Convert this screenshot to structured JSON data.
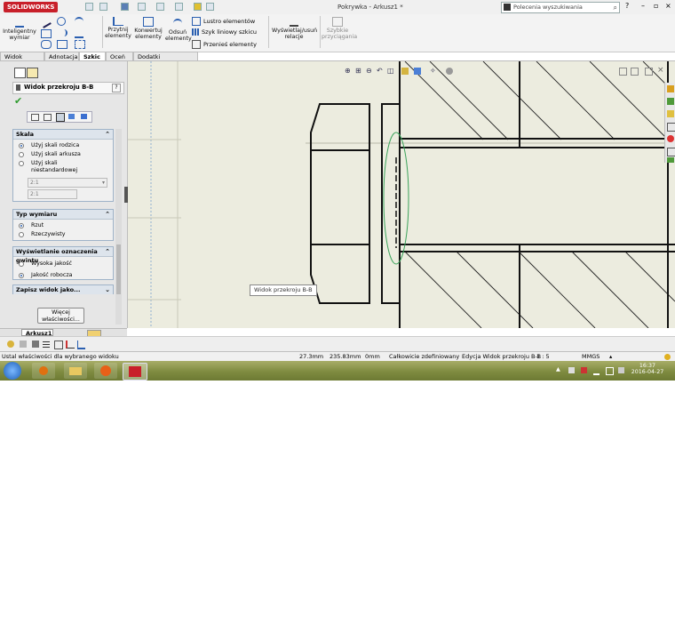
{
  "app": {
    "logo_text": "SOLIDWORKS",
    "document_title": "Pokrywka - Arkusz1 *",
    "search_placeholder": "Polecenia wyszukiwania"
  },
  "ribbon": {
    "smart_dimension": "Inteligentny wymiar",
    "trim": "Przytnij elementy",
    "convert": "Konwertuj elementy",
    "offset": "Odsuń elementy",
    "mirror": "Lustro elementów",
    "linear_pattern": "Szyk liniowy szkicu",
    "move": "Przenieś elementy",
    "relations": "Wyświetlaj/usuń relacje",
    "quick_snaps": "Szybkie przyciągania"
  },
  "tabs": [
    "Widok układu",
    "Adnotacja",
    "Szkic",
    "Oceń",
    "Dodatki SOLIDWORKS"
  ],
  "active_tab": "Szkic",
  "panel": {
    "title": "Widok przekroju B-B",
    "scale": {
      "header": "Skala",
      "options": [
        "Użyj skali rodzica",
        "Użyj skali arkusza",
        "Użyj skali niestandardowej"
      ],
      "selected": 0,
      "custom_value": "2:1",
      "custom_value2": "2:1"
    },
    "dimension_type": {
      "header": "Typ wymiaru",
      "options": [
        "Rzut",
        "Rzeczywisty"
      ],
      "selected": 0
    },
    "thread_display": {
      "header": "Wyświetlanie oznaczenia gwintu",
      "options": [
        "Wysoka jakość",
        "Jakość robocza"
      ],
      "selected": 1
    },
    "save_view": "Zapisz widok jako...",
    "more_props": "Więcej właściwości..."
  },
  "sheet_tab": "Arkusz1",
  "canvas": {
    "tooltip": "Widok przekroju B-B"
  },
  "status": {
    "message": "Ustal właściwości dla wybranego widoku",
    "x": "27.3mm",
    "y": "235.83mm",
    "z": "0mm",
    "definition": "Całkowicie zdefiniowany",
    "edit": "Edycja Widok przekroju B-B",
    "scale": "1 : 5",
    "units": "MMGS"
  },
  "taskbar": {
    "time": "16:37",
    "date": "2016-04-27"
  },
  "colors": {
    "brand": "#c8202a",
    "canvas": "#ececdf",
    "ellipse": "#3aa35a"
  }
}
